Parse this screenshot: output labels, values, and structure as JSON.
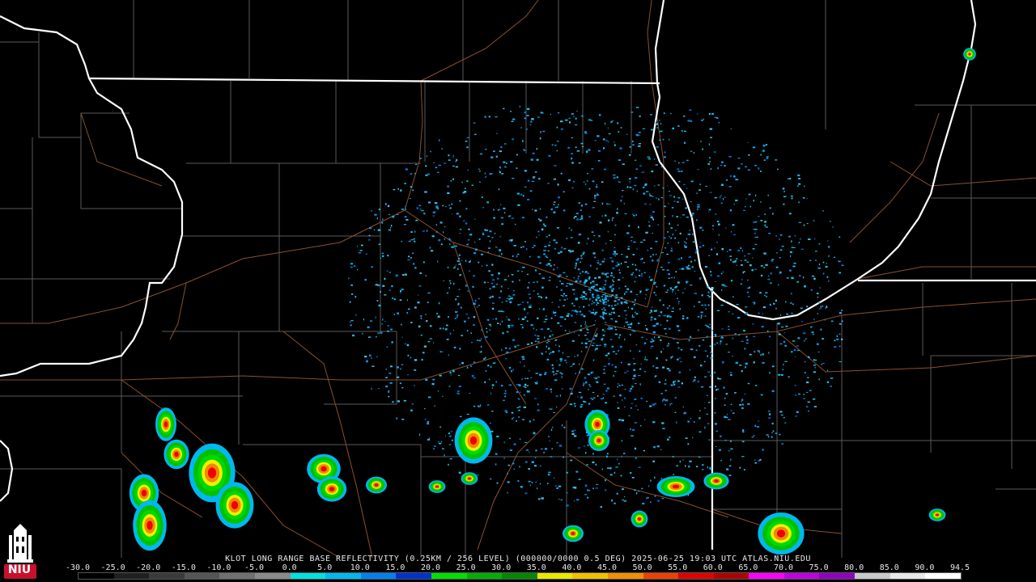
{
  "caption": "KLOT LONG RANGE BASE REFLECTIVITY (0.25KM / 256 LEVEL) (000000/0000 0.5 DEG) 2025-06-25 19:03 UTC  ATLAS.NIU.EDU",
  "logo": {
    "text": "NIU",
    "icon": "university-tower-logo-icon"
  },
  "scale": {
    "labels": [
      "-30.0",
      "-25.0",
      "-20.0",
      "-15.0",
      "-10.0",
      "-5.0",
      "0.0",
      "5.0",
      "10.0",
      "15.0",
      "20.0",
      "25.0",
      "30.0",
      "35.0",
      "40.0",
      "45.0",
      "50.0",
      "55.0",
      "60.0",
      "65.0",
      "70.0",
      "75.0",
      "80.0",
      "85.0",
      "90.0",
      "94.5"
    ],
    "colors": [
      "#000000",
      "#1a1a1a",
      "#333333",
      "#4d4d4d",
      "#666666",
      "#808080",
      "#00e0e0",
      "#00a0f0",
      "#0050f0",
      "#0000c0",
      "#00d800",
      "#00a800",
      "#008000",
      "#f0f000",
      "#f0c000",
      "#f08800",
      "#f00000",
      "#c80000",
      "#a00000",
      "#f000f0",
      "#a000e0",
      "#7800c0",
      "#d8d8d8",
      "#f0f0f0",
      "#ffffff",
      "#ffffff"
    ]
  },
  "radar": {
    "site": "KLOT"
  }
}
